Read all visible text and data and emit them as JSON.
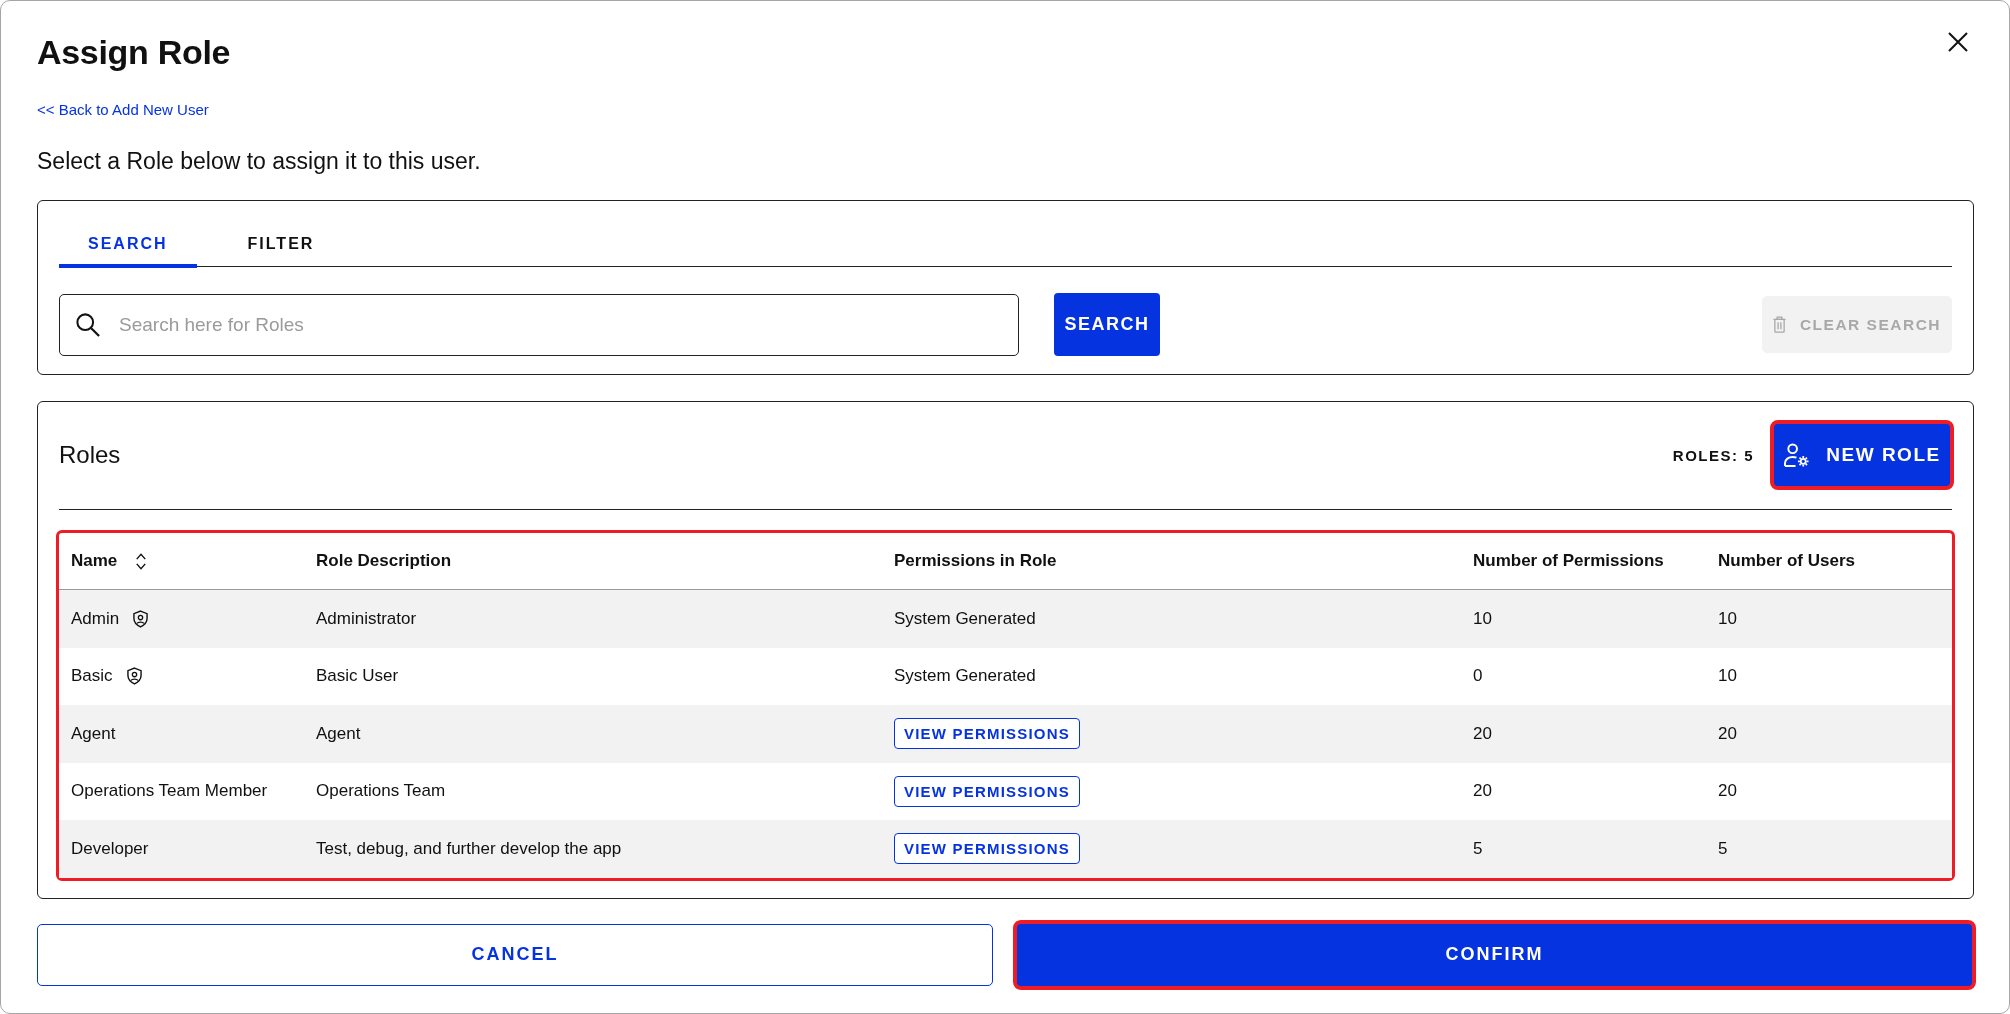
{
  "dialog": {
    "title": "Assign Role",
    "back_link": "<< Back to Add New User",
    "instruction": "Select a Role below to assign it to this user."
  },
  "search_panel": {
    "tabs": [
      {
        "label": "SEARCH",
        "selected": true
      },
      {
        "label": "FILTER",
        "selected": false
      }
    ],
    "search_field": {
      "placeholder": "Search here for Roles"
    },
    "search_button": "SEARCH",
    "clear_button": {
      "label": "CLEAR SEARCH",
      "disabled": true
    }
  },
  "roles_panel": {
    "title": "Roles",
    "count": "ROLES: 5",
    "new_role_button": {
      "label": "NEW ROLE",
      "highlighted": true
    },
    "table": {
      "highlighted": true,
      "columns": [
        {
          "label": "Name",
          "sortable": true
        },
        {
          "label": "Role Description",
          "sortable": false
        },
        {
          "label": "Permissions in Role",
          "sortable": false
        },
        {
          "label": "Number of Permissions",
          "sortable": false
        },
        {
          "label": "Number of Users",
          "sortable": false
        }
      ],
      "rows": [
        {
          "name": "Admin",
          "system": true,
          "description": "Administrator",
          "permissions": {
            "kind": "text",
            "text": "System Generated"
          },
          "permission_count": "10",
          "user_count": "10"
        },
        {
          "name": "Basic",
          "system": true,
          "description": "Basic User",
          "permissions": {
            "kind": "text",
            "text": "System Generated"
          },
          "permission_count": "0",
          "user_count": "10"
        },
        {
          "name": "Agent",
          "system": false,
          "description": "Agent",
          "permissions": {
            "kind": "button",
            "text": "VIEW PERMISSIONS"
          },
          "permission_count": "20",
          "user_count": "20"
        },
        {
          "name": "Operations Team Member",
          "system": false,
          "description": "Operations Team",
          "permissions": {
            "kind": "button",
            "text": "VIEW PERMISSIONS"
          },
          "permission_count": "20",
          "user_count": "20"
        },
        {
          "name": "Developer",
          "system": false,
          "description": "Test, debug, and further develop the app",
          "permissions": {
            "kind": "button",
            "text": "VIEW PERMISSIONS"
          },
          "permission_count": "5",
          "user_count": "5"
        }
      ]
    }
  },
  "actions": [
    {
      "label": "CANCEL",
      "kind": "secondary",
      "highlighted": false
    },
    {
      "label": "CONFIRM",
      "kind": "primary",
      "highlighted": true
    }
  ]
}
